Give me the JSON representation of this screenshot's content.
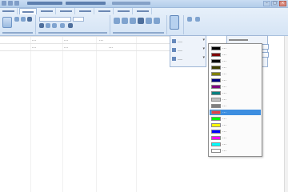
{
  "titlebar": {
    "min": "–",
    "max": "□",
    "close": "×"
  },
  "ribbon": {
    "tab_count": 12
  },
  "sheet": {
    "rows": [
      {
        "c1": "…",
        "c2": "…",
        "c3": "…"
      },
      {
        "c1": "…",
        "c2": "…",
        "c3": "…"
      }
    ]
  },
  "side_panel": {
    "rows": [
      {
        "label": "…",
        "value": "…",
        "arrow": "▾"
      },
      {
        "label": "…",
        "value": "…",
        "arrow": "▾"
      },
      {
        "label": "…",
        "value": "…",
        "arrow": "▾"
      }
    ]
  },
  "color_list": [
    {
      "color": "#000000",
      "label": "…"
    },
    {
      "color": "#7f0000",
      "label": "…"
    },
    {
      "color": "#0c0c0c",
      "label": "…"
    },
    {
      "color": "#404000",
      "label": "…"
    },
    {
      "color": "#808000",
      "label": "…"
    },
    {
      "color": "#000080",
      "label": "…"
    },
    {
      "color": "#800080",
      "label": "…"
    },
    {
      "color": "#008080",
      "label": "…"
    },
    {
      "color": "#c0c0c0",
      "label": "…"
    },
    {
      "color": "#808080",
      "label": "…"
    },
    {
      "color": "#e0404a",
      "label": "…",
      "selected": true
    },
    {
      "color": "#00ff00",
      "label": "…"
    },
    {
      "color": "#ffff00",
      "label": "…"
    },
    {
      "color": "#0000ff",
      "label": "…"
    },
    {
      "color": "#ff00ff",
      "label": "…"
    },
    {
      "color": "#00ffff",
      "label": "…"
    },
    {
      "color": "#ffffff",
      "label": "…"
    }
  ],
  "colors": {
    "accent": "#3d8ee0",
    "ribbon": "#dbe8f6"
  }
}
